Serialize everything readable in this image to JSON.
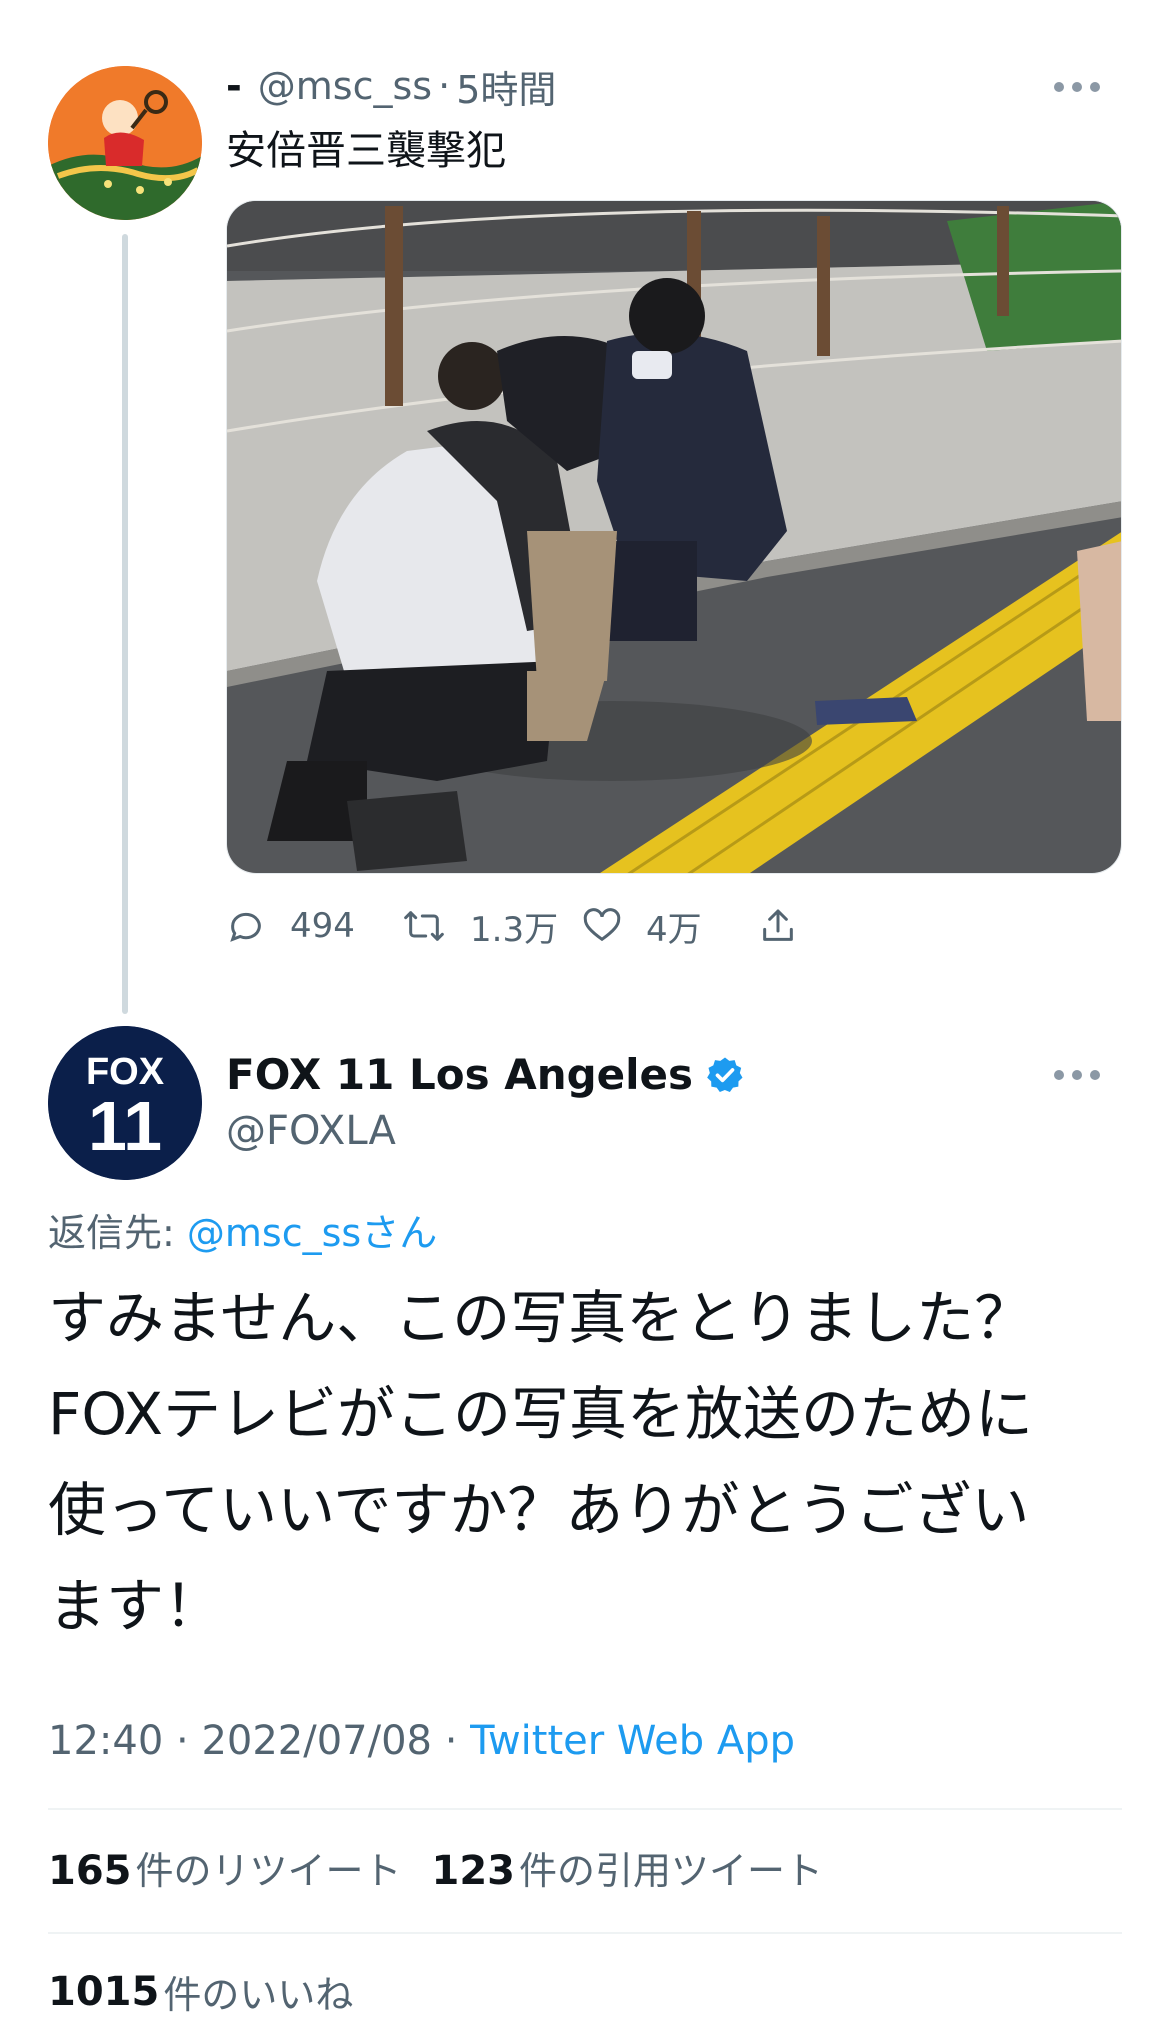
{
  "parent_tweet": {
    "display_name": "-",
    "handle": "@msc_ss",
    "separator": "·",
    "time_ago": "5時間",
    "text": "安倍晋三襲撃犯",
    "actions": {
      "replies": "494",
      "retweets": "1.3万",
      "likes": "4万"
    }
  },
  "reply_tweet": {
    "display_name": "FOX 11 Los Angeles",
    "verified": true,
    "handle": "@FOXLA",
    "avatar_text": {
      "top": "FOX",
      "bottom": "11"
    },
    "reply_to_label": "返信先:",
    "reply_to_handle": "@msc_ss",
    "reply_to_suffix": "さん",
    "text_lines": [
      "すみません、この写真をとりました？",
      "FOXテレビがこの写真を放送のために",
      "使っていいですか？ありがとうござい",
      "ます！"
    ],
    "time": "12:40",
    "date": "2022/07/08",
    "separator": "·",
    "source_app": "Twitter Web App",
    "stats": {
      "retweets_count": "165",
      "retweets_label": "件のリツイート",
      "quotes_count": "123",
      "quotes_label": "件の引用ツイート",
      "likes_count": "1015",
      "likes_label": "件のいいね"
    }
  },
  "colors": {
    "accent": "#1d9bf0",
    "secondary_text": "#536471",
    "thread_line": "#cfd9de",
    "tactile_paving": "#e6c21f"
  },
  "icons": [
    "reply-icon",
    "retweet-icon",
    "like-icon",
    "share-icon",
    "more-icon",
    "verified-badge-icon"
  ]
}
